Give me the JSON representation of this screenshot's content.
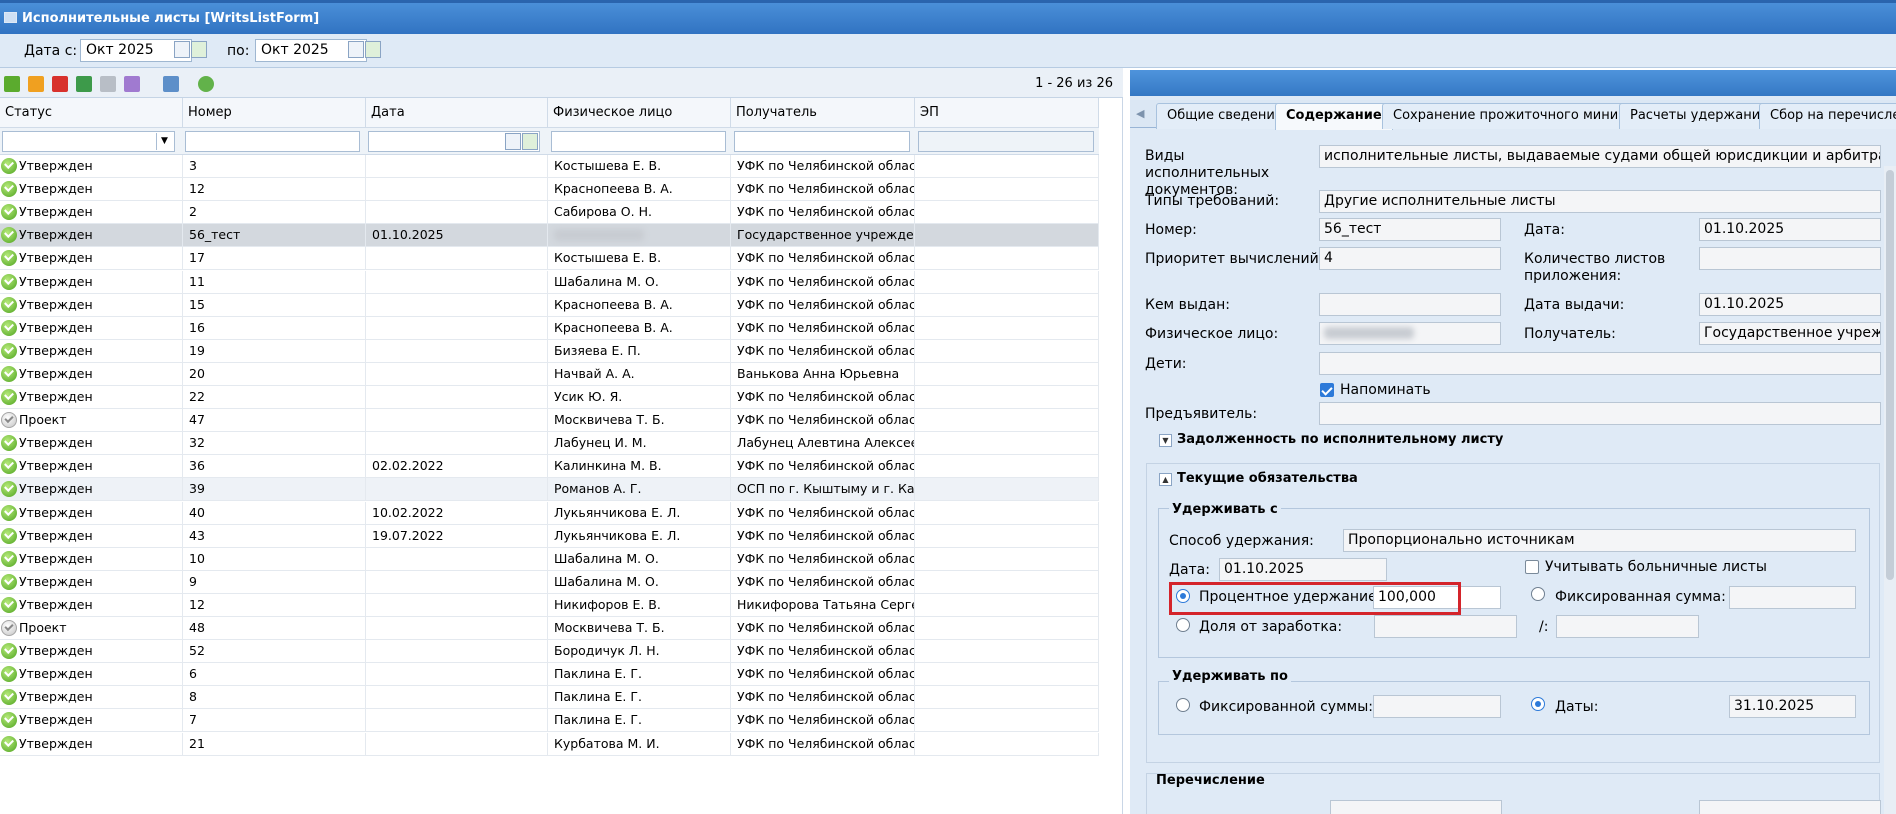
{
  "window": {
    "title": "Исполнительные листы [WritsListForm]"
  },
  "filters": {
    "date_from_label": "Дата с:",
    "date_from": "Окт 2025",
    "date_to_label": "по:",
    "date_to": "Окт 2025"
  },
  "toolbar": {
    "page_count": "1 - 26 из 26"
  },
  "grid": {
    "columns": [
      "Статус",
      "Номер",
      "Дата",
      "Физическое лицо",
      "Получатель",
      "ЭП"
    ],
    "rows": [
      {
        "status": "Утвержден",
        "s": "ok",
        "num": "3",
        "date": "",
        "person": "Костышева Е. В.",
        "recipient": "УФК по Челябинской област..."
      },
      {
        "status": "Утвержден",
        "s": "ok",
        "num": "12",
        "date": "",
        "person": "Краснопеева В. А.",
        "recipient": "УФК по Челябинской област..."
      },
      {
        "status": "Утвержден",
        "s": "ok",
        "num": "2",
        "date": "",
        "person": "Сабирова О. Н.",
        "recipient": "УФК по Челябинской област..."
      },
      {
        "status": "Утвержден",
        "s": "ok",
        "num": "56_тест",
        "date": "01.10.2025",
        "person": "",
        "recipient": "Государственное учрежден...",
        "selected": true
      },
      {
        "status": "Утвержден",
        "s": "ok",
        "num": "17",
        "date": "",
        "person": "Костышева Е. В.",
        "recipient": "УФК по Челябинской област..."
      },
      {
        "status": "Утвержден",
        "s": "ok",
        "num": "11",
        "date": "",
        "person": "Шабалина М. О.",
        "recipient": "УФК по Челябинской област..."
      },
      {
        "status": "Утвержден",
        "s": "ok",
        "num": "15",
        "date": "",
        "person": "Краснопеева В. А.",
        "recipient": "УФК по Челябинской област..."
      },
      {
        "status": "Утвержден",
        "s": "ok",
        "num": "16",
        "date": "",
        "person": "Краснопеева В. А.",
        "recipient": "УФК по Челябинской област..."
      },
      {
        "status": "Утвержден",
        "s": "ok",
        "num": "19",
        "date": "",
        "person": "Бизяева Е. П.",
        "recipient": "УФК по Челябинской област..."
      },
      {
        "status": "Утвержден",
        "s": "ok",
        "num": "20",
        "date": "",
        "person": "Начвай А. А.",
        "recipient": "Ванькова Анна Юрьевна"
      },
      {
        "status": "Утвержден",
        "s": "ok",
        "num": "22",
        "date": "",
        "person": "Усик Ю. Я.",
        "recipient": "УФК по Челябинской област..."
      },
      {
        "status": "Проект",
        "s": "pr",
        "num": "47",
        "date": "",
        "person": "Москвичева Т. Б.",
        "recipient": "УФК по Челябинской област..."
      },
      {
        "status": "Утвержден",
        "s": "ok",
        "num": "32",
        "date": "",
        "person": "Лабунец И. М.",
        "recipient": "Лабунец Алевтина Алексеев..."
      },
      {
        "status": "Утвержден",
        "s": "ok",
        "num": "36",
        "date": "02.02.2022",
        "person": "Калинкина М. В.",
        "recipient": "УФК по Челябинской област..."
      },
      {
        "status": "Утвержден",
        "s": "ok",
        "num": "39",
        "date": "",
        "person": "Романов А. Г.",
        "recipient": "ОСП по г. Кыштыму и г. Кар...",
        "alt": true
      },
      {
        "status": "Утвержден",
        "s": "ok",
        "num": "40",
        "date": "10.02.2022",
        "person": "Лукьянчикова Е. Л.",
        "recipient": "УФК по Челябинской област..."
      },
      {
        "status": "Утвержден",
        "s": "ok",
        "num": "43",
        "date": "19.07.2022",
        "person": "Лукьянчикова Е. Л.",
        "recipient": "УФК по Челябинской област..."
      },
      {
        "status": "Утвержден",
        "s": "ok",
        "num": "10",
        "date": "",
        "person": "Шабалина М. О.",
        "recipient": "УФК по Челябинской област..."
      },
      {
        "status": "Утвержден",
        "s": "ok",
        "num": "9",
        "date": "",
        "person": "Шабалина М. О.",
        "recipient": "УФК по Челябинской област..."
      },
      {
        "status": "Утвержден",
        "s": "ok",
        "num": "12",
        "date": "",
        "person": "Никифоров Е. В.",
        "recipient": "Никифорова Татьяна Серге..."
      },
      {
        "status": "Проект",
        "s": "pr",
        "num": "48",
        "date": "",
        "person": "Москвичева Т. Б.",
        "recipient": "УФК по Челябинской област..."
      },
      {
        "status": "Утвержден",
        "s": "ok",
        "num": "52",
        "date": "",
        "person": "Бородичук Л. Н.",
        "recipient": "УФК по Челябинской област..."
      },
      {
        "status": "Утвержден",
        "s": "ok",
        "num": "6",
        "date": "",
        "person": "Паклина Е. Г.",
        "recipient": "УФК по Челябинской област..."
      },
      {
        "status": "Утвержден",
        "s": "ok",
        "num": "8",
        "date": "",
        "person": "Паклина Е. Г.",
        "recipient": "УФК по Челябинской област..."
      },
      {
        "status": "Утвержден",
        "s": "ok",
        "num": "7",
        "date": "",
        "person": "Паклина Е. Г.",
        "recipient": "УФК по Челябинской област..."
      },
      {
        "status": "Утвержден",
        "s": "ok",
        "num": "21",
        "date": "",
        "person": "Курбатова М. И.",
        "recipient": "УФК по Челябинской област..."
      }
    ]
  },
  "tabs": [
    "Общие сведения",
    "Содержание",
    "Сохранение прожиточного минимума",
    "Расчеты удержаний",
    "Сбор на перечислени"
  ],
  "form": {
    "doc_kinds_label": "Виды исполнительных документов:",
    "doc_kinds": "исполнительные листы, выдаваемые судами общей юрисдикции и арбитражными судам",
    "req_types_label": "Типы требований:",
    "req_types": "Другие исполнительные листы",
    "number_label": "Номер:",
    "number": "56_тест",
    "date_label": "Дата:",
    "date": "01.10.2025",
    "priority_label": "Приоритет вычислений:",
    "priority": "4",
    "sheets_label": "Количество листов приложения:",
    "sheets": "",
    "issued_by_label": "Кем выдан:",
    "issued_by": "",
    "issue_date_label": "Дата выдачи:",
    "issue_date": "01.10.2025",
    "person_label": "Физическое лицо:",
    "recipient_label": "Получатель:",
    "recipient": "Государственное учреждени",
    "children_label": "Дети:",
    "children": "",
    "remind_label": "Напоминать",
    "presenter_label": "Предъявитель:",
    "presenter": "",
    "debt_section": "Задолженность по исполнительному листу",
    "current_section": "Текущие обязательства",
    "hold_from": {
      "title": "Удерживать с",
      "method_label": "Способ удержания:",
      "method": "Пропорционально источникам",
      "date_label": "Дата:",
      "date": "01.10.2025",
      "sick_label": "Учитывать больничные листы",
      "percent_label": "Процентное удержание:",
      "percent": "100,000",
      "fixed_label": "Фиксированная сумма:",
      "fixed": "",
      "share_label": "Доля от заработка:",
      "share": "",
      "share_sep": "/:",
      "share2": ""
    },
    "hold_to": {
      "title": "Удерживать по",
      "fixed_label": "Фиксированной суммы:",
      "fixed": "",
      "dates_label": "Даты:",
      "dates": "31.10.2025"
    },
    "transfer_section": "Перечисление"
  },
  "colors": {
    "accent": "#3578c4",
    "highlight": "#d4242b",
    "ok": "#4ea31f"
  }
}
